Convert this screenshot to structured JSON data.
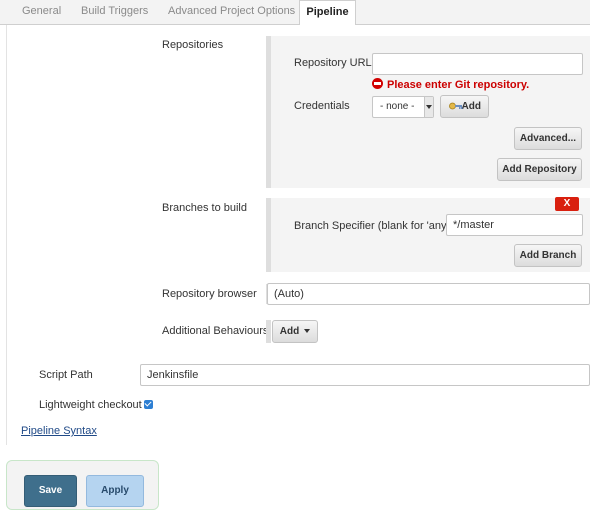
{
  "tabs": [
    {
      "label": "General"
    },
    {
      "label": "Build Triggers"
    },
    {
      "label": "Advanced Project Options"
    },
    {
      "label": "Pipeline"
    }
  ],
  "repositories": {
    "label": "Repositories",
    "url_label": "Repository URL",
    "url_value": "",
    "error_text": "Please enter Git repository.",
    "credentials_label": "Credentials",
    "credentials_value": "- none -",
    "add_credentials_label": "Add",
    "advanced_label": "Advanced...",
    "add_repository_label": "Add Repository"
  },
  "branches": {
    "label": "Branches to build",
    "delete_label": "X",
    "specifier_label": "Branch Specifier (blank for 'any')",
    "specifier_value": "*/master",
    "add_branch_label": "Add Branch"
  },
  "repo_browser": {
    "label": "Repository browser",
    "value": "(Auto)"
  },
  "additional_behaviours": {
    "label": "Additional Behaviours",
    "add_label": "Add"
  },
  "script_path": {
    "label": "Script Path",
    "value": "Jenkinsfile"
  },
  "lightweight": {
    "label": "Lightweight checkout",
    "checked": true
  },
  "pipeline_syntax_label": "Pipeline Syntax",
  "footer": {
    "save_label": "Save",
    "apply_label": "Apply"
  },
  "colors": {
    "error": "#cc0000",
    "save": "#3f6f8c",
    "apply": "#b5d4f0",
    "delete": "#d9200f",
    "checkbox": "#2d7fd3"
  },
  "icons": [
    "error-icon",
    "key-icon",
    "chevron-down-icon",
    "checkmark-icon"
  ]
}
